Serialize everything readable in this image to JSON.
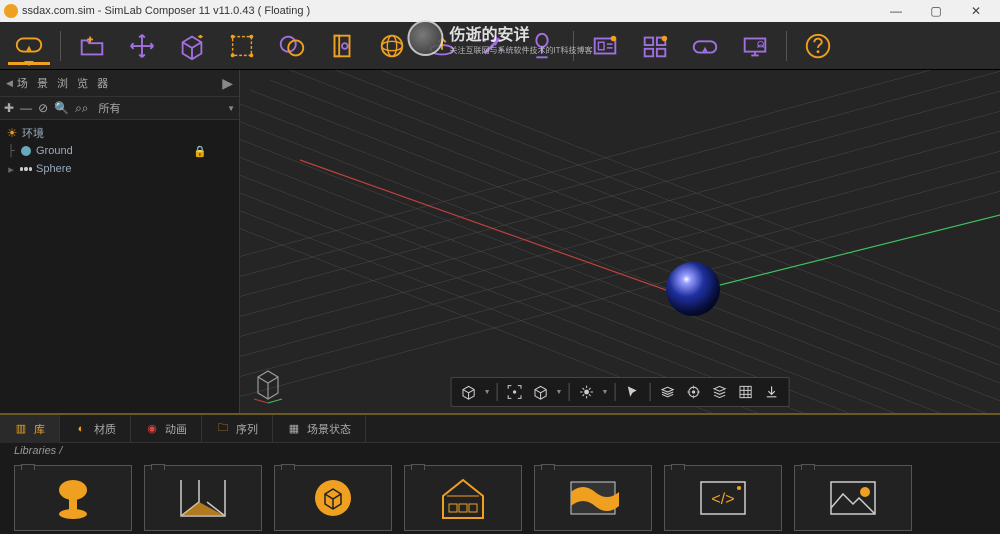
{
  "titlebar": {
    "file": "ssdax.com.sim",
    "app": "SimLab Composer 11",
    "ver": "v11.0.43",
    "lic": "( Floating )"
  },
  "watermark": {
    "big": "伤逝的安详",
    "small": "关注互联网与系统软件技术的IT科技博客"
  },
  "toolbar": {
    "items": [
      "vr",
      "open",
      "move",
      "cube",
      "select",
      "materials",
      "notes",
      "globe",
      "ring",
      "magic",
      "vr2",
      "present",
      "layout",
      "headset",
      "screen",
      "help"
    ]
  },
  "sidebar": {
    "title": "场 景 浏 览 器",
    "filter": "所有",
    "tools": [
      "add",
      "minus",
      "link",
      "search",
      "bino"
    ],
    "tree": [
      {
        "icon": "sun",
        "label": "环境",
        "indent": 0
      },
      {
        "icon": "globe",
        "label": "Ground",
        "lock": true,
        "indent": 1
      },
      {
        "icon": "dots",
        "label": "Sphere",
        "indent": 1,
        "expand": true
      }
    ]
  },
  "vp_tools": [
    "box",
    "dd",
    "focus",
    "cube2",
    "dd",
    "bulb",
    "dd",
    "cursor",
    "sep",
    "layers",
    "target",
    "stack",
    "grid",
    "down"
  ],
  "btabs": [
    {
      "label": "库",
      "icon": "lib",
      "active": true
    },
    {
      "label": "材质",
      "icon": "mat"
    },
    {
      "label": "动画",
      "icon": "anim"
    },
    {
      "label": "序列",
      "icon": "seq"
    },
    {
      "label": "场景状态",
      "icon": "state"
    }
  ],
  "breadcrumb": "Libraries  /",
  "lib_items": [
    "chair",
    "room",
    "box",
    "house",
    "flag",
    "code",
    "image"
  ]
}
